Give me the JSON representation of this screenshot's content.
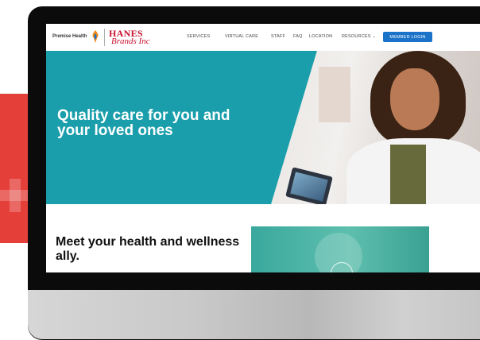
{
  "header": {
    "logo_text": "Premise Health",
    "brand_name": "HANES",
    "brand_sub": "Brands Inc"
  },
  "nav": {
    "items": [
      "SERVICES",
      "VIRTUAL CARE",
      "STAFF",
      "FAQ",
      "LOCATION"
    ],
    "resources": "RESOURCES",
    "member_login": "MEMBER LOGIN"
  },
  "hero": {
    "title": "Quality care for you and your loved ones"
  },
  "section": {
    "title": "Meet your health and wellness ally."
  },
  "colors": {
    "accent_teal": "#1a9eab",
    "brand_red": "#c8102e",
    "button_blue": "#1a73c8",
    "side_red": "#e53f3a"
  },
  "icons": [
    "premise-flame-icon",
    "chevron-down-icon",
    "play-icon"
  ]
}
